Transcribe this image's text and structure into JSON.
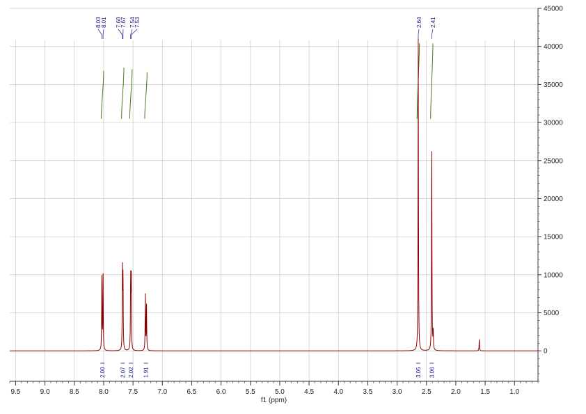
{
  "chart_data": {
    "type": "line",
    "xlabel": "f1 (ppm)",
    "ylabel": "",
    "xlim": [
      9.6,
      0.6
    ],
    "ylim": [
      -4000,
      45000
    ],
    "x_reversed": true,
    "grid": true,
    "x_ticks": [
      "9.5",
      "9.0",
      "8.5",
      "8.0",
      "7.5",
      "7.0",
      "6.5",
      "6.0",
      "5.5",
      "5.0",
      "4.5",
      "4.0",
      "3.5",
      "3.0",
      "2.5",
      "2.0",
      "1.5",
      "1.0"
    ],
    "y_ticks": [
      "45000",
      "40000",
      "35000",
      "30000",
      "25000",
      "20000",
      "15000",
      "10000",
      "5000",
      "0"
    ],
    "peaks": [
      {
        "ppm": 8.03,
        "height": 10200
      },
      {
        "ppm": 8.01,
        "height": 9800
      },
      {
        "ppm": 7.68,
        "height": 10300
      },
      {
        "ppm": 7.67,
        "height": 9500
      },
      {
        "ppm": 7.54,
        "height": 9600
      },
      {
        "ppm": 7.53,
        "height": 9200
      },
      {
        "ppm": 7.29,
        "height": 7300
      },
      {
        "ppm": 7.27,
        "height": 6300
      },
      {
        "ppm": 2.64,
        "height": 41000
      },
      {
        "ppm": 2.41,
        "height": 27800
      },
      {
        "ppm": 2.385,
        "height": 2300
      },
      {
        "ppm": 1.6,
        "height": 1600
      }
    ],
    "peak_labels": [
      "8.03",
      "8.01",
      "7.68",
      "7.67",
      "7.54",
      "7.53",
      "2.64",
      "2.41"
    ],
    "integrals": [
      {
        "value": "2.00",
        "ppm": 8.02
      },
      {
        "value": "2.07",
        "ppm": 7.675
      },
      {
        "value": "2.02",
        "ppm": 7.535
      },
      {
        "value": "1.91",
        "ppm": 7.28
      },
      {
        "value": "3.05",
        "ppm": 2.64
      },
      {
        "value": "3.06",
        "ppm": 2.41
      }
    ],
    "colors": {
      "spectrum": "#8b0000",
      "integral_curve": "#4a7a1c",
      "label": "#1a1a8c",
      "grid": "#c8c8c8",
      "axis": "#333333"
    }
  }
}
